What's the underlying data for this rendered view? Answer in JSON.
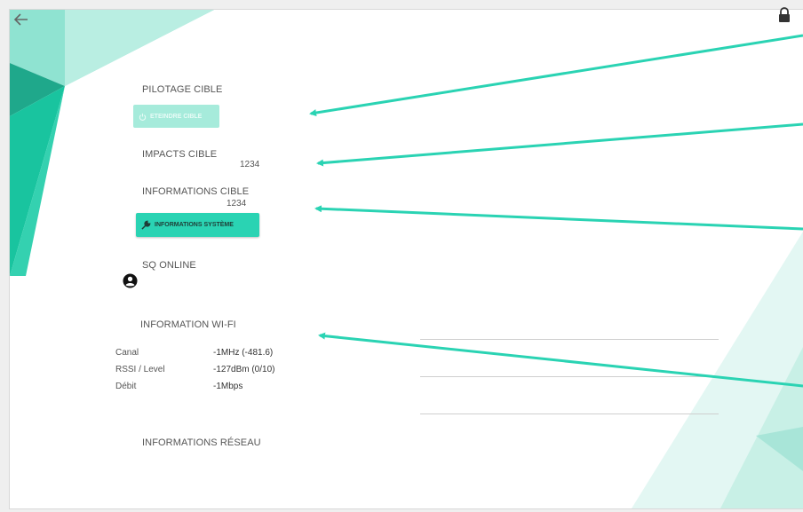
{
  "header": {
    "back_icon": "arrow-left-icon",
    "lock_icon": "lock-icon"
  },
  "pilotage": {
    "title": "PILOTAGE CIBLE",
    "button_label": "ETEINDRE CIBLE",
    "button_icon": "power-icon"
  },
  "impacts": {
    "title": "IMPACTS CIBLE",
    "value": "1234"
  },
  "informations": {
    "title": "INFORMATIONS CIBLE",
    "value": "1234",
    "button_label": "INFORMATIONS SYSTÈME",
    "button_icon": "wrench-icon"
  },
  "sq_online": {
    "title": "SQ ONLINE",
    "icon": "account-circle-icon"
  },
  "wifi": {
    "title": "INFORMATION WI-FI",
    "rows": [
      {
        "label": "Canal",
        "value": "-1MHz (-481.6)"
      },
      {
        "label": "RSSI / Level",
        "value": "-127dBm (0/10)"
      },
      {
        "label": "Débit",
        "value": "-1Mbps"
      }
    ]
  },
  "reseau": {
    "title": "INFORMATIONS RÉSEAU"
  },
  "colors": {
    "accent": "#2ad3b3",
    "accent_light": "#a6ebdb",
    "arrow": "#2ad3b3"
  }
}
